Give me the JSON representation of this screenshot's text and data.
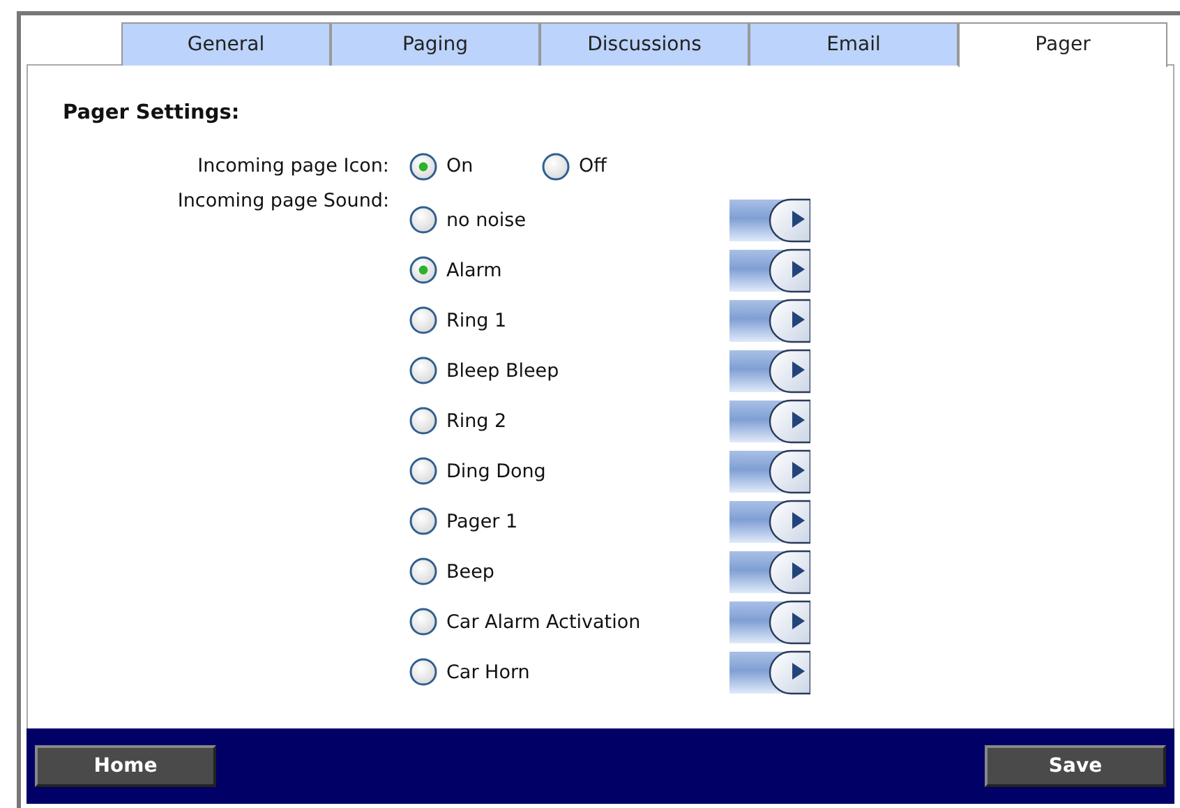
{
  "tabs": [
    {
      "label": "General",
      "selected": false
    },
    {
      "label": "Paging",
      "selected": false
    },
    {
      "label": "Discussions",
      "selected": false
    },
    {
      "label": "Email",
      "selected": false
    },
    {
      "label": "Pager",
      "selected": true
    }
  ],
  "heading": "Pager Settings:",
  "icon_setting": {
    "label": "Incoming page Icon:",
    "options": [
      {
        "label": "On",
        "selected": true
      },
      {
        "label": "Off",
        "selected": false
      }
    ]
  },
  "sound_setting": {
    "label": "Incoming page Sound:",
    "options": [
      {
        "label": "no noise",
        "selected": false
      },
      {
        "label": "Alarm",
        "selected": true
      },
      {
        "label": "Ring 1",
        "selected": false
      },
      {
        "label": "Bleep Bleep",
        "selected": false
      },
      {
        "label": "Ring 2",
        "selected": false
      },
      {
        "label": "Ding Dong",
        "selected": false
      },
      {
        "label": "Pager 1",
        "selected": false
      },
      {
        "label": "Beep",
        "selected": false
      },
      {
        "label": "Car Alarm Activation",
        "selected": false
      },
      {
        "label": "Car Horn",
        "selected": false
      }
    ]
  },
  "buttons": [
    "Home",
    "Save"
  ]
}
